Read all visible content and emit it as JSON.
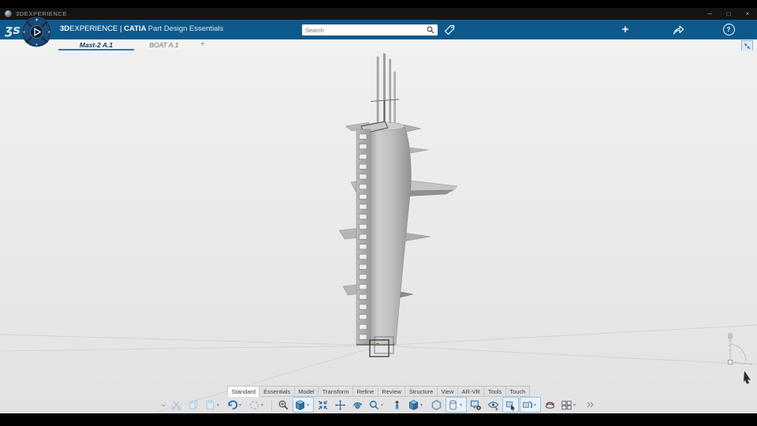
{
  "window": {
    "title": "3DEXPERIENCE",
    "minimize": "─",
    "maximize": "□",
    "close": "×"
  },
  "header": {
    "bg_color": "#0e598c",
    "brand_bold": "3D",
    "brand_rest": "EXPERIENCE",
    "divider": " | ",
    "app_bold": "CATIA ",
    "app_rest": "Part Design Essentials",
    "search_placeholder": "Search",
    "add": "+",
    "help": "?",
    "icons": [
      "tag-icon",
      "add-icon",
      "share-icon",
      "help-icon"
    ]
  },
  "doc_tabs": {
    "items": [
      {
        "label": "Mast-2 A.1",
        "active": true
      },
      {
        "label": "BOAT A.1",
        "active": false
      }
    ],
    "add": "+",
    "accent": "#2779bd"
  },
  "ribbon": {
    "active": "Standard",
    "tabs": [
      "Standard",
      "Essentials",
      "Model",
      "Transform",
      "Refine",
      "Review",
      "Structure",
      "View",
      "AR-VR",
      "Tools",
      "Touch"
    ]
  },
  "toolbar": {
    "icons": [
      "toolbar-options",
      "cut",
      "copy",
      "paste",
      "undo",
      "history",
      "zoom-in",
      "isometric-view",
      "fit-all",
      "pan",
      "rotate",
      "zoom",
      "look-at",
      "named-views",
      "perspective-mode",
      "render-style",
      "display-settings",
      "hide-show",
      "select-box",
      "rotate-view",
      "update",
      "split-view",
      "more-commands"
    ]
  },
  "viewport": {
    "model_name": "Mast-2 3D model",
    "bg_top": "#f0f0f1",
    "bg_bottom": "#e2e2e4",
    "model_gray": "#b9bbbd",
    "has_axis_triad": true
  }
}
